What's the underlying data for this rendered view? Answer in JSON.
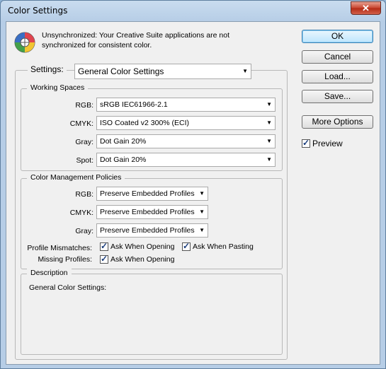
{
  "window": {
    "title": "Color Settings",
    "close_glyph": "✕"
  },
  "sync": {
    "icon": "color-wheel-icon",
    "message": "Unsynchronized: Your Creative Suite applications are not synchronized for consistent color."
  },
  "buttons": {
    "ok": "OK",
    "cancel": "Cancel",
    "load": "Load...",
    "save": "Save...",
    "more_options": "More Options"
  },
  "preview": {
    "label": "Preview",
    "checked": true
  },
  "settings": {
    "label": "Settings:",
    "value": "General Color Settings"
  },
  "working_spaces": {
    "legend": "Working Spaces",
    "rgb": {
      "label": "RGB:",
      "value": "sRGB IEC61966-2.1"
    },
    "cmyk": {
      "label": "CMYK:",
      "value": "ISO Coated v2 300% (ECI)"
    },
    "gray": {
      "label": "Gray:",
      "value": "Dot Gain 20%"
    },
    "spot": {
      "label": "Spot:",
      "value": "Dot Gain 20%"
    }
  },
  "policies": {
    "legend": "Color Management Policies",
    "rgb": {
      "label": "RGB:",
      "value": "Preserve Embedded Profiles"
    },
    "cmyk": {
      "label": "CMYK:",
      "value": "Preserve Embedded Profiles"
    },
    "gray": {
      "label": "Gray:",
      "value": "Preserve Embedded Profiles"
    },
    "mismatch_label": "Profile Mismatches:",
    "mismatch_open": "Ask When Opening",
    "mismatch_paste": "Ask When Pasting",
    "missing_label": "Missing Profiles:",
    "missing_open": "Ask When Opening"
  },
  "description": {
    "legend": "Description",
    "text": "General Color Settings:"
  }
}
